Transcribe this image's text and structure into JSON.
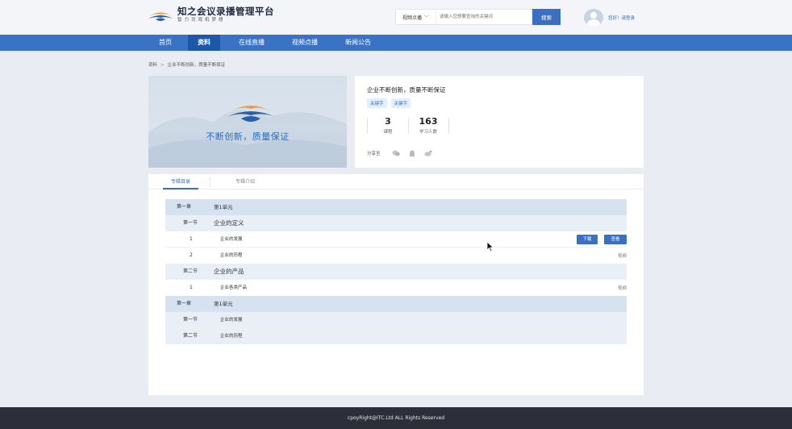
{
  "header": {
    "logo_title": "知之会议录播管理平台",
    "logo_subtitle": "智力司戏机梦想",
    "search": {
      "type_label": "视频点播",
      "placeholder": "请输入您想要查询的关键词",
      "button_label": "搜索"
    },
    "user_text": "您好！请登录"
  },
  "nav": {
    "items": [
      {
        "label": "首页",
        "active": false
      },
      {
        "label": "资料",
        "active": true
      },
      {
        "label": "在线直播",
        "active": false
      },
      {
        "label": "视频点播",
        "active": false
      },
      {
        "label": "新闻公告",
        "active": false
      }
    ]
  },
  "breadcrumb": {
    "root": "资料",
    "separator": ">",
    "current": "企业不断创新，质量不断保证"
  },
  "banner": {
    "text": "不断创新，质量保证"
  },
  "info": {
    "title": "企业不断创新，质量不断保证",
    "tags": [
      "关键字",
      "关键字"
    ],
    "stats": [
      {
        "value": "3",
        "label": "课程"
      },
      {
        "value": "163",
        "label": "学习人数"
      }
    ],
    "share_label": "分享至",
    "share_icons": [
      "wechat-icon",
      "qq-icon",
      "weibo-icon"
    ]
  },
  "tabs": {
    "catalog": "专辑目录",
    "intro": "专辑介绍"
  },
  "tree": {
    "ch1": {
      "label": "第一章",
      "title": "第1单元"
    },
    "ch1_s1": {
      "label": "第一节",
      "title": "企业的定义"
    },
    "ch1_s1_i1": {
      "num": "1",
      "title": "企业的发展",
      "download": "下载",
      "view": "查看"
    },
    "ch1_s1_i2": {
      "num": "2",
      "title": "企业的历程",
      "type": "视频"
    },
    "ch1_s2": {
      "label": "第二节",
      "title": "企业的产品"
    },
    "ch1_s2_i1": {
      "num": "1",
      "title": "企业各类产品",
      "type": "视频"
    },
    "ch2": {
      "label": "第一章",
      "title": "第1单元"
    },
    "ch2_s1": {
      "label": "第一节",
      "title": "企业的发展"
    },
    "ch2_s2": {
      "label": "第二节",
      "title": "企业的历程"
    }
  },
  "footer": {
    "text": "cpoyRight@ITC.Ltd ALL Rights Reserved"
  },
  "colors": {
    "brand_blue": "#3a72c4",
    "nav_active": "#1d58a8",
    "accent_orange": "#f09a3e",
    "footer_bg": "#2c2f3a"
  }
}
